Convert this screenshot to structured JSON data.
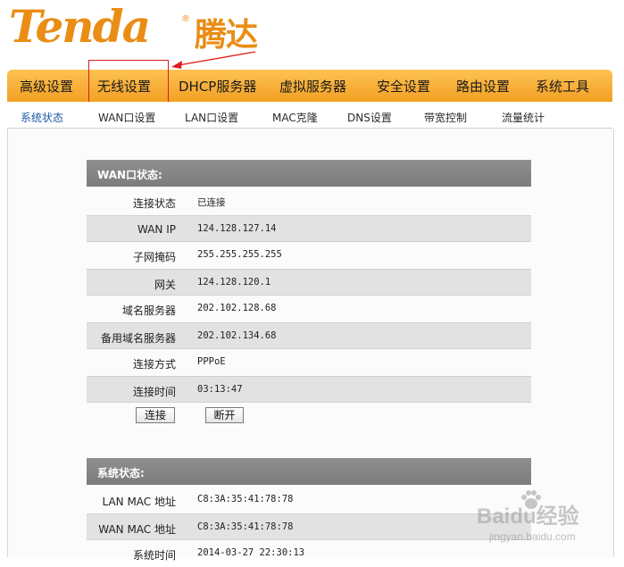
{
  "logo": {
    "brand_en": "Tenda",
    "reg_mark": "®",
    "brand_cn": "腾达"
  },
  "nav": {
    "items": [
      {
        "label": "高级设置"
      },
      {
        "label": "无线设置"
      },
      {
        "label": "DHCP服务器"
      },
      {
        "label": "虚拟服务器"
      },
      {
        "label": "安全设置"
      },
      {
        "label": "路由设置"
      },
      {
        "label": "系统工具"
      }
    ]
  },
  "subnav": {
    "items": [
      {
        "label": "系统状态",
        "active": true
      },
      {
        "label": "WAN口设置"
      },
      {
        "label": "LAN口设置"
      },
      {
        "label": "MAC克隆"
      },
      {
        "label": "DNS设置"
      },
      {
        "label": "带宽控制"
      },
      {
        "label": "流量统计"
      }
    ]
  },
  "wan": {
    "title": "WAN口状态:",
    "rows": [
      {
        "label": "连接状态",
        "value": "已连接"
      },
      {
        "label": "WAN IP",
        "value": "124.128.127.14"
      },
      {
        "label": "子网掩码",
        "value": "255.255.255.255"
      },
      {
        "label": "网关",
        "value": "124.128.120.1"
      },
      {
        "label": "域名服务器",
        "value": "202.102.128.68"
      },
      {
        "label": "备用域名服务器",
        "value": "202.102.134.68"
      },
      {
        "label": "连接方式",
        "value": "PPPoE"
      },
      {
        "label": "连接时间",
        "value": "03:13:47"
      }
    ],
    "connect_label": "连接",
    "disconnect_label": "断开"
  },
  "system": {
    "title": "系统状态:",
    "rows": [
      {
        "label": "LAN MAC 地址",
        "value": "C8:3A:35:41:78:78"
      },
      {
        "label": "WAN MAC 地址",
        "value": "C8:3A:35:41:78:78"
      },
      {
        "label": "系统时间",
        "value": "2014-03-27 22:30:13"
      }
    ]
  },
  "watermark": {
    "main": "Baidu经验",
    "sub": "jingyan.baidu.com"
  },
  "colors": {
    "brand": "#e98d14",
    "nav_top": "#fdc253",
    "nav_bottom": "#f3a023",
    "section_header": "#858585",
    "row_shade": "#e2e2e2",
    "annotation": "#e0191b",
    "active_subnav": "#1d5aa6"
  }
}
